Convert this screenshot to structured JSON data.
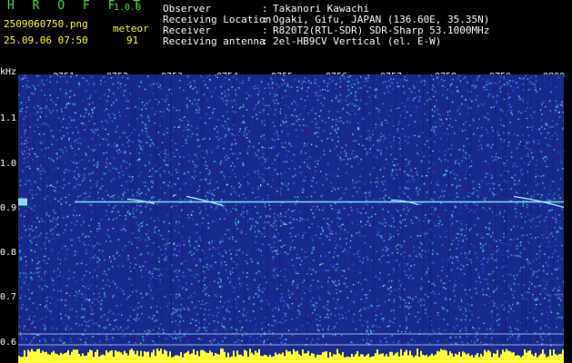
{
  "header": {
    "app_title": "H R O F F T",
    "app_version": "1.0.0",
    "file_name": "2509060750.png",
    "datetime": "25.09.06 07:50",
    "meteor_label": "meteor",
    "meteor_count": "91"
  },
  "info": [
    {
      "key": "Observer",
      "value": "Takanori Kawachi"
    },
    {
      "key": "Receiving Location",
      "value": "Ogaki, Gifu, JAPAN (136.60E, 35.35N)"
    },
    {
      "key": "Receiver",
      "value": "R820T2(RTL-SDR) SDR-Sharp 53.1000MHz"
    },
    {
      "key": "Receiving antenna",
      "value": "2el-HB9CV Vertical (el. E-W)"
    }
  ],
  "info_sep": ":",
  "y_axis": {
    "unit": "kHz",
    "ticks": [
      "1.1",
      "1.0",
      "0.9",
      "0.8",
      "0.7",
      "0.6"
    ]
  },
  "x_axis": {
    "ticks": [
      "0751",
      "0752",
      "0753",
      "0754",
      "0755",
      "0756",
      "0757",
      "0758",
      "0759",
      "0800"
    ]
  },
  "colors": {
    "background": "#1a2a8c",
    "carrier": "#7fe6ff",
    "noise_floor": "#ffff40"
  },
  "carrier_frequency_khz": 0.905
}
